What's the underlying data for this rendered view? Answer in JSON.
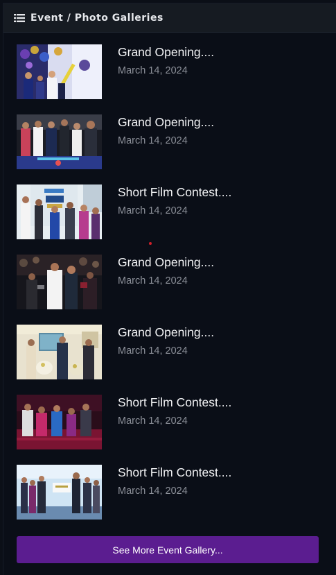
{
  "header": {
    "title": "Event / Photo Galleries",
    "icon": "list-icon"
  },
  "items": [
    {
      "title": "Grand Opening....",
      "date": "March 14, 2024",
      "thumb": "balloons-ribbon-photo"
    },
    {
      "title": "Grand Opening....",
      "date": "March 14, 2024",
      "thumb": "ribbon-cutting-photo"
    },
    {
      "title": "Short Film Contest....",
      "date": "March 14, 2024",
      "thumb": "contest-banner-interview-photo"
    },
    {
      "title": "Grand Opening....",
      "date": "March 14, 2024",
      "thumb": "press-crowd-photo"
    },
    {
      "title": "Grand Opening....",
      "date": "March 14, 2024",
      "thumb": "lamp-lighting-photo"
    },
    {
      "title": "Short Film Contest....",
      "date": "March 14, 2024",
      "thumb": "audience-seated-photo"
    },
    {
      "title": "Short Film Contest....",
      "date": "March 14, 2024",
      "thumb": "award-cheque-stage-photo"
    }
  ],
  "footer": {
    "button_label": "See More Event Gallery..."
  },
  "colors": {
    "background": "#0a0e17",
    "header_bg": "#161b22",
    "button_bg": "#5b1d90",
    "title_text": "#f2f3f5",
    "date_text": "#8c9099"
  }
}
